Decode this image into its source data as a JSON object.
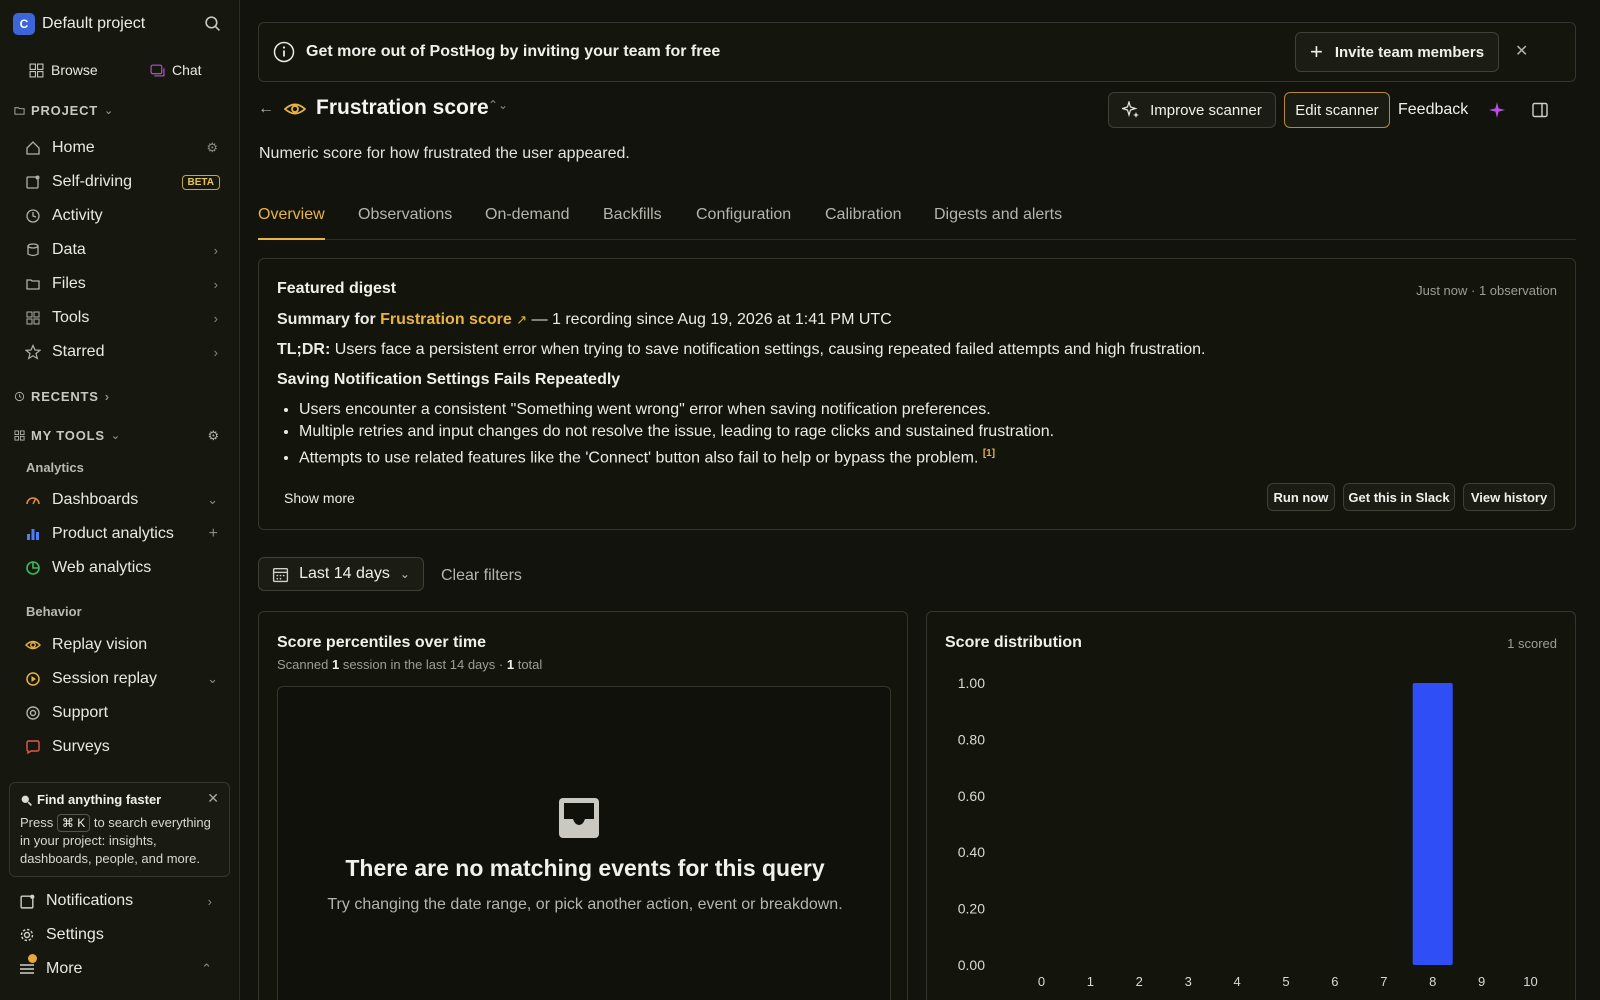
{
  "sidebar": {
    "project_initial": "C",
    "project_name": "Default project",
    "browse_label": "Browse",
    "chat_label": "Chat",
    "project_section": "PROJECT",
    "nav": [
      {
        "label": "Home"
      },
      {
        "label": "Self-driving",
        "badge": "BETA"
      },
      {
        "label": "Activity"
      },
      {
        "label": "Data"
      },
      {
        "label": "Files"
      },
      {
        "label": "Tools"
      },
      {
        "label": "Starred"
      }
    ],
    "recents_section": "RECENTS",
    "my_tools_section": "MY TOOLS",
    "analytics_group": "Analytics",
    "analytics_items": [
      {
        "label": "Dashboards"
      },
      {
        "label": "Product analytics"
      },
      {
        "label": "Web analytics"
      }
    ],
    "behavior_group": "Behavior",
    "behavior_items": [
      {
        "label": "Replay vision"
      },
      {
        "label": "Session replay"
      },
      {
        "label": "Support"
      },
      {
        "label": "Surveys"
      }
    ],
    "tip": {
      "title": "Find anything faster",
      "press": "Press",
      "shortcut": "⌘ K",
      "rest": "to search everything in your project: insights, dashboards, people, and more."
    },
    "notifications_label": "Notifications",
    "settings_label": "Settings",
    "more_label": "More"
  },
  "banner": {
    "text": "Get more out of PostHog by inviting your team for free",
    "invite_button": "Invite team members"
  },
  "header": {
    "title": "Frustration score",
    "description": "Numeric score for how frustrated the user appeared.",
    "improve_button": "Improve scanner",
    "edit_button": "Edit scanner",
    "feedback_button": "Feedback"
  },
  "tabs": [
    "Overview",
    "Observations",
    "On-demand",
    "Backfills",
    "Configuration",
    "Calibration",
    "Digests and alerts"
  ],
  "digest": {
    "heading": "Featured digest",
    "meta": "Just now · 1 observation",
    "summary_prefix": "Summary for",
    "summary_link": "Frustration score",
    "summary_suffix": "— 1 recording since Aug 19, 2026 at 1:41 PM UTC",
    "tldr_label": "TL;DR:",
    "tldr_text": "Users face a persistent error when trying to save notification settings, causing repeated failed attempts and high frustration.",
    "section_title": "Saving Notification Settings Fails Repeatedly",
    "bullets": [
      "Users encounter a consistent \"Something went wrong\" error when saving notification preferences.",
      "Multiple retries and input changes do not resolve the issue, leading to rage clicks and sustained frustration.",
      "Attempts to use related features like the 'Connect' button also fail to help or bypass the problem."
    ],
    "footnote": "[1]",
    "show_more": "Show more",
    "run_now": "Run now",
    "slack": "Get this in Slack",
    "history": "View history"
  },
  "filters": {
    "date_range": "Last 14 days",
    "clear": "Clear filters"
  },
  "percentiles_card": {
    "title": "Score percentiles over time",
    "sub_prefix": "Scanned",
    "sub_count": "1",
    "sub_mid": "session in the last 14 days ·",
    "sub_total": "1",
    "sub_suffix": "total",
    "empty_title": "There are no matching events for this query",
    "empty_sub": "Try changing the date range, or pick another action, event or breakdown."
  },
  "distribution_card": {
    "title": "Score distribution",
    "meta": "1 scored"
  },
  "chart_data": {
    "type": "bar",
    "title": "Score distribution",
    "categories": [
      "0",
      "1",
      "2",
      "3",
      "4",
      "5",
      "6",
      "7",
      "8",
      "9",
      "10"
    ],
    "values": [
      0,
      0,
      0,
      0,
      0,
      0,
      0,
      0,
      1.0,
      0,
      0
    ],
    "yticks": [
      "1.00",
      "0.80",
      "0.60",
      "0.40",
      "0.20",
      "0.00"
    ],
    "ylim": [
      0,
      1
    ],
    "bar_color": "#2f4ef5",
    "grid": false
  }
}
